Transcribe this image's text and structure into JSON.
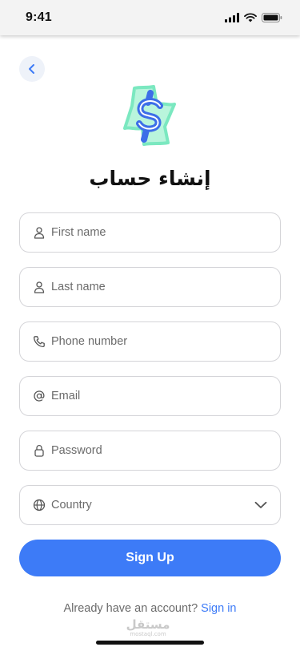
{
  "status_bar": {
    "time": "9:41",
    "icons": [
      "signal-icon",
      "wifi-icon",
      "battery-icon"
    ]
  },
  "back_button": {
    "icon": "chevron-left-icon"
  },
  "logo": {
    "icon": "dollar-sign-icon",
    "colors": {
      "stroke": "#3d6ee8",
      "glow": "#7be8c0"
    }
  },
  "title": "إنشاء حساب",
  "form": {
    "first_name": {
      "placeholder": "First name",
      "value": "",
      "icon": "user-icon"
    },
    "last_name": {
      "placeholder": "Last name",
      "value": "",
      "icon": "user-icon"
    },
    "phone": {
      "placeholder": "Phone number",
      "value": "",
      "icon": "phone-icon"
    },
    "email": {
      "placeholder": "Email",
      "value": "",
      "icon": "at-sign-icon"
    },
    "password": {
      "placeholder": "Password",
      "value": "",
      "icon": "lock-icon"
    },
    "country": {
      "label": "Country",
      "icon": "globe-icon",
      "dropdown_icon": "chevron-down-icon"
    }
  },
  "signup_button": {
    "label": "Sign Up"
  },
  "footer": {
    "text": "Already have an account?",
    "link": "Sign in"
  },
  "watermark": {
    "main": "مستقل",
    "sub": "mostaql.com"
  },
  "colors": {
    "accent": "#3d7bf7",
    "border": "#d4d4d8",
    "placeholder": "#6b6b6b",
    "back_button_bg": "#eef2f9"
  }
}
